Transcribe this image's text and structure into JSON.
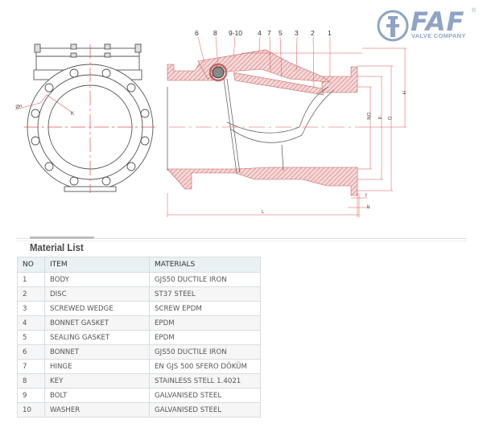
{
  "brand": {
    "name": "FAF",
    "subtitle": "VALVE COMPANY",
    "registered": "®",
    "color": "#8fa3c4"
  },
  "drawing": {
    "callouts": [
      "6",
      "8",
      "9-10",
      "4",
      "7",
      "5",
      "3",
      "2",
      "1"
    ],
    "dimension_labels": {
      "H": "H",
      "D": "D",
      "d": "d",
      "DN": "DN",
      "L": "L",
      "f": "f",
      "b": "b",
      "K": "K",
      "holes": "Øn"
    },
    "colors": {
      "section_hatch": "#d97c7c",
      "centerline": "#d95555",
      "outline": "#555555"
    }
  },
  "material_list": {
    "title": "Material List",
    "columns": [
      "NO",
      "ITEM",
      "MATERIALS"
    ],
    "rows": [
      {
        "no": "1",
        "item": "BODY",
        "material": "GJS50 DUCTILE IRON"
      },
      {
        "no": "2",
        "item": "DISC",
        "material": "ST37 STEEL"
      },
      {
        "no": "3",
        "item": "SCREWED WEDGE",
        "material": "SCREW EPDM"
      },
      {
        "no": "4",
        "item": "BONNET GASKET",
        "material": "EPDM"
      },
      {
        "no": "5",
        "item": "SEALING GASKET",
        "material": "EPDM"
      },
      {
        "no": "6",
        "item": "BONNET",
        "material": "GJS50 DUCTILE IRON"
      },
      {
        "no": "7",
        "item": "HINGE",
        "material": "EN GJS 500 SFERO DÖKÜM"
      },
      {
        "no": "8",
        "item": "KEY",
        "material": "STAINLESS STELL 1.4021"
      },
      {
        "no": "9",
        "item": "BOLT",
        "material": "GALVANISED STEEL"
      },
      {
        "no": "10",
        "item": "WASHER",
        "material": "GALVANISED STEEL"
      }
    ]
  }
}
